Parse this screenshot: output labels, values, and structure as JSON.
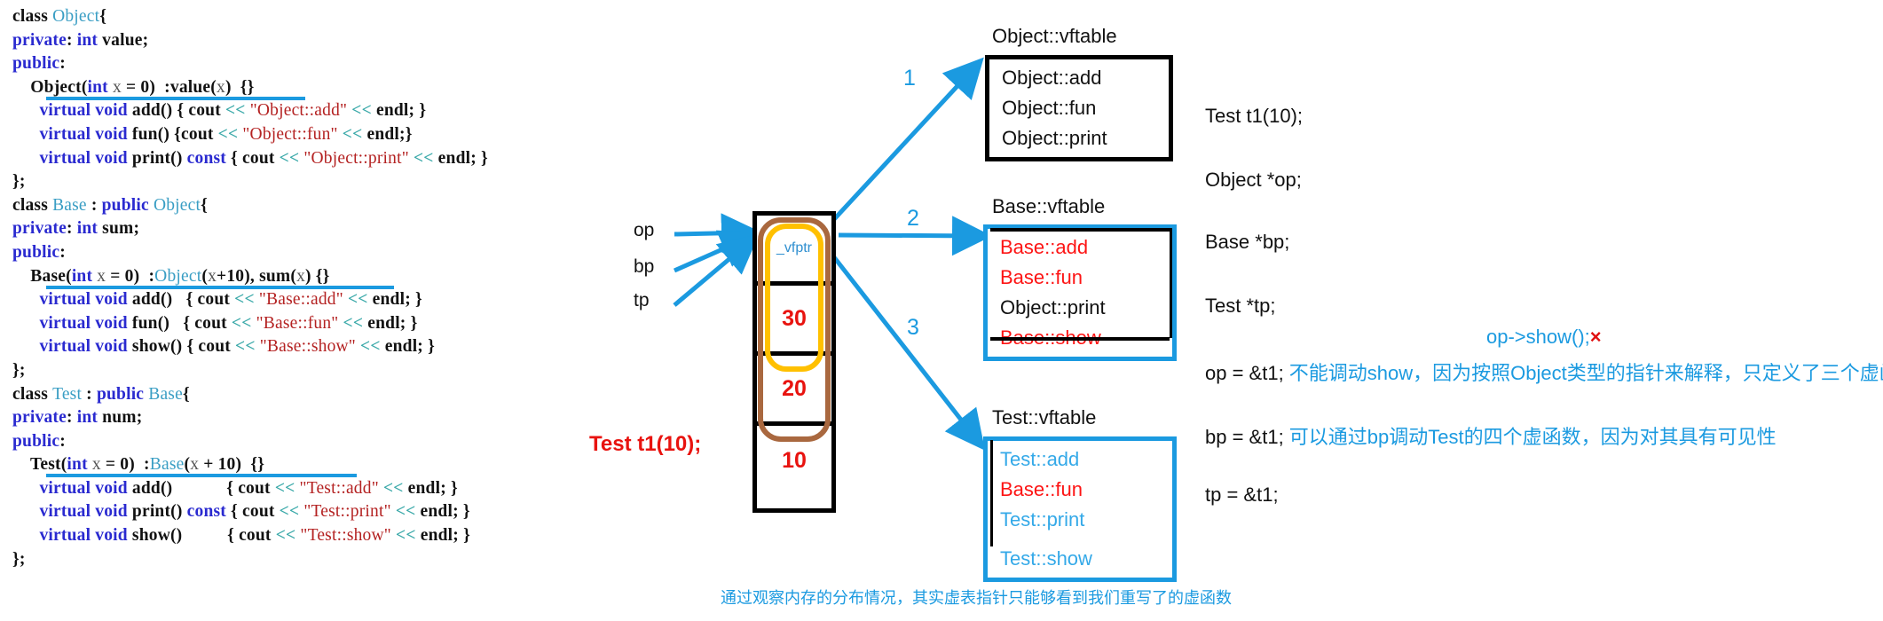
{
  "code": {
    "lines": [
      [
        {
          "t": "class ",
          "c": "plain"
        },
        {
          "t": "Object",
          "c": "typ"
        },
        {
          "t": "{",
          "c": "plain"
        }
      ],
      [
        {
          "t": "private",
          "c": "kw"
        },
        {
          "t": ": ",
          "c": "plain"
        },
        {
          "t": "int",
          "c": "kw"
        },
        {
          "t": " value;",
          "c": "plain"
        }
      ],
      [
        {
          "t": "public",
          "c": "kw"
        },
        {
          "t": ":",
          "c": "plain"
        }
      ],
      [
        {
          "t": "    Object",
          "c": "plain"
        },
        {
          "t": "(",
          "c": "plain"
        },
        {
          "t": "int",
          "c": "kw"
        },
        {
          "t": " ",
          "c": "plain"
        },
        {
          "t": "x",
          "c": "var"
        },
        {
          "t": " = ",
          "c": "plain"
        },
        {
          "t": "0",
          "c": "plain"
        },
        {
          "t": ")  :value",
          "c": "plain"
        },
        {
          "t": "(",
          "c": "plain"
        },
        {
          "t": "x",
          "c": "var"
        },
        {
          "t": ")  {}",
          "c": "plain"
        }
      ],
      [
        {
          "t": "      ",
          "c": "plain"
        },
        {
          "t": "virtual",
          "c": "kw"
        },
        {
          "t": " ",
          "c": "plain"
        },
        {
          "t": "void",
          "c": "kw"
        },
        {
          "t": " add() { cout ",
          "c": "plain"
        },
        {
          "t": "<<",
          "c": "op"
        },
        {
          "t": " ",
          "c": "plain"
        },
        {
          "t": "\"Object::add\"",
          "c": "str"
        },
        {
          "t": " ",
          "c": "plain"
        },
        {
          "t": "<<",
          "c": "op"
        },
        {
          "t": " endl; }",
          "c": "plain"
        }
      ],
      [
        {
          "t": "      ",
          "c": "plain"
        },
        {
          "t": "virtual",
          "c": "kw"
        },
        {
          "t": " ",
          "c": "plain"
        },
        {
          "t": "void",
          "c": "kw"
        },
        {
          "t": " fun() {cout ",
          "c": "plain"
        },
        {
          "t": "<<",
          "c": "op"
        },
        {
          "t": " ",
          "c": "plain"
        },
        {
          "t": "\"Object::fun\"",
          "c": "str"
        },
        {
          "t": " ",
          "c": "plain"
        },
        {
          "t": "<<",
          "c": "op"
        },
        {
          "t": " endl;}",
          "c": "plain"
        }
      ],
      [
        {
          "t": "      ",
          "c": "plain"
        },
        {
          "t": "virtual",
          "c": "kw"
        },
        {
          "t": " ",
          "c": "plain"
        },
        {
          "t": "void",
          "c": "kw"
        },
        {
          "t": " print() ",
          "c": "plain"
        },
        {
          "t": "const",
          "c": "kw"
        },
        {
          "t": " { cout ",
          "c": "plain"
        },
        {
          "t": "<<",
          "c": "op"
        },
        {
          "t": " ",
          "c": "plain"
        },
        {
          "t": "\"Object::print\"",
          "c": "str"
        },
        {
          "t": " ",
          "c": "plain"
        },
        {
          "t": "<<",
          "c": "op"
        },
        {
          "t": " endl; }",
          "c": "plain"
        }
      ],
      [
        {
          "t": "};",
          "c": "plain"
        }
      ],
      [
        {
          "t": "class ",
          "c": "plain"
        },
        {
          "t": "Base",
          "c": "typ"
        },
        {
          "t": " : ",
          "c": "plain"
        },
        {
          "t": "public",
          "c": "kw"
        },
        {
          "t": " ",
          "c": "plain"
        },
        {
          "t": "Object",
          "c": "typ"
        },
        {
          "t": "{",
          "c": "plain"
        }
      ],
      [
        {
          "t": "private",
          "c": "kw"
        },
        {
          "t": ": ",
          "c": "plain"
        },
        {
          "t": "int",
          "c": "kw"
        },
        {
          "t": " sum;",
          "c": "plain"
        }
      ],
      [
        {
          "t": "public",
          "c": "kw"
        },
        {
          "t": ":",
          "c": "plain"
        }
      ],
      [
        {
          "t": "    Base",
          "c": "plain"
        },
        {
          "t": "(",
          "c": "plain"
        },
        {
          "t": "int",
          "c": "kw"
        },
        {
          "t": " ",
          "c": "plain"
        },
        {
          "t": "x",
          "c": "var"
        },
        {
          "t": " = ",
          "c": "plain"
        },
        {
          "t": "0",
          "c": "plain"
        },
        {
          "t": ")  :",
          "c": "plain"
        },
        {
          "t": "Object",
          "c": "typ"
        },
        {
          "t": "(",
          "c": "plain"
        },
        {
          "t": "x",
          "c": "var"
        },
        {
          "t": "+10), sum",
          "c": "plain"
        },
        {
          "t": "(",
          "c": "plain"
        },
        {
          "t": "x",
          "c": "var"
        },
        {
          "t": ") {}",
          "c": "plain"
        }
      ],
      [
        {
          "t": "      ",
          "c": "plain"
        },
        {
          "t": "virtual",
          "c": "kw"
        },
        {
          "t": " ",
          "c": "plain"
        },
        {
          "t": "void",
          "c": "kw"
        },
        {
          "t": " add()   { cout ",
          "c": "plain"
        },
        {
          "t": "<<",
          "c": "op"
        },
        {
          "t": " ",
          "c": "plain"
        },
        {
          "t": "\"Base::add\"",
          "c": "str"
        },
        {
          "t": " ",
          "c": "plain"
        },
        {
          "t": "<<",
          "c": "op"
        },
        {
          "t": " endl; }",
          "c": "plain"
        }
      ],
      [
        {
          "t": "      ",
          "c": "plain"
        },
        {
          "t": "virtual",
          "c": "kw"
        },
        {
          "t": " ",
          "c": "plain"
        },
        {
          "t": "void",
          "c": "kw"
        },
        {
          "t": " fun()   { cout ",
          "c": "plain"
        },
        {
          "t": "<<",
          "c": "op"
        },
        {
          "t": " ",
          "c": "plain"
        },
        {
          "t": "\"Base::fun\"",
          "c": "str"
        },
        {
          "t": " ",
          "c": "plain"
        },
        {
          "t": "<<",
          "c": "op"
        },
        {
          "t": " endl; }",
          "c": "plain"
        }
      ],
      [
        {
          "t": "      ",
          "c": "plain"
        },
        {
          "t": "virtual",
          "c": "kw"
        },
        {
          "t": " ",
          "c": "plain"
        },
        {
          "t": "void",
          "c": "kw"
        },
        {
          "t": " show() { cout ",
          "c": "plain"
        },
        {
          "t": "<<",
          "c": "op"
        },
        {
          "t": " ",
          "c": "plain"
        },
        {
          "t": "\"Base::show\"",
          "c": "str"
        },
        {
          "t": " ",
          "c": "plain"
        },
        {
          "t": "<<",
          "c": "op"
        },
        {
          "t": " endl; }",
          "c": "plain"
        }
      ],
      [
        {
          "t": "};",
          "c": "plain"
        }
      ],
      [
        {
          "t": "class ",
          "c": "plain"
        },
        {
          "t": "Test",
          "c": "typ"
        },
        {
          "t": " : ",
          "c": "plain"
        },
        {
          "t": "public",
          "c": "kw"
        },
        {
          "t": " ",
          "c": "plain"
        },
        {
          "t": "Base",
          "c": "typ"
        },
        {
          "t": "{",
          "c": "plain"
        }
      ],
      [
        {
          "t": "private",
          "c": "kw"
        },
        {
          "t": ": ",
          "c": "plain"
        },
        {
          "t": "int",
          "c": "kw"
        },
        {
          "t": " num;",
          "c": "plain"
        }
      ],
      [
        {
          "t": "public",
          "c": "kw"
        },
        {
          "t": ":",
          "c": "plain"
        }
      ],
      [
        {
          "t": "    Test",
          "c": "plain"
        },
        {
          "t": "(",
          "c": "plain"
        },
        {
          "t": "int",
          "c": "kw"
        },
        {
          "t": " ",
          "c": "plain"
        },
        {
          "t": "x",
          "c": "var"
        },
        {
          "t": " = ",
          "c": "plain"
        },
        {
          "t": "0",
          "c": "plain"
        },
        {
          "t": ")  :",
          "c": "plain"
        },
        {
          "t": "Base",
          "c": "typ"
        },
        {
          "t": "(",
          "c": "plain"
        },
        {
          "t": "x",
          "c": "var"
        },
        {
          "t": " + 10)  {}",
          "c": "plain"
        }
      ],
      [
        {
          "t": "      ",
          "c": "plain"
        },
        {
          "t": "virtual",
          "c": "kw"
        },
        {
          "t": " ",
          "c": "plain"
        },
        {
          "t": "void",
          "c": "kw"
        },
        {
          "t": " add()            { cout ",
          "c": "plain"
        },
        {
          "t": "<<",
          "c": "op"
        },
        {
          "t": " ",
          "c": "plain"
        },
        {
          "t": "\"Test::add\"",
          "c": "str"
        },
        {
          "t": " ",
          "c": "plain"
        },
        {
          "t": "<<",
          "c": "op"
        },
        {
          "t": " endl; }",
          "c": "plain"
        }
      ],
      [
        {
          "t": "      ",
          "c": "plain"
        },
        {
          "t": "virtual",
          "c": "kw"
        },
        {
          "t": " ",
          "c": "plain"
        },
        {
          "t": "void",
          "c": "kw"
        },
        {
          "t": " print() ",
          "c": "plain"
        },
        {
          "t": "const",
          "c": "kw"
        },
        {
          "t": " { cout ",
          "c": "plain"
        },
        {
          "t": "<<",
          "c": "op"
        },
        {
          "t": " ",
          "c": "plain"
        },
        {
          "t": "\"Test::print\"",
          "c": "str"
        },
        {
          "t": " ",
          "c": "plain"
        },
        {
          "t": "<<",
          "c": "op"
        },
        {
          "t": " endl; }",
          "c": "plain"
        }
      ],
      [
        {
          "t": "      ",
          "c": "plain"
        },
        {
          "t": "virtual",
          "c": "kw"
        },
        {
          "t": " ",
          "c": "plain"
        },
        {
          "t": "void",
          "c": "kw"
        },
        {
          "t": " show()          { cout ",
          "c": "plain"
        },
        {
          "t": "<<",
          "c": "op"
        },
        {
          "t": " ",
          "c": "plain"
        },
        {
          "t": "\"Test::show\"",
          "c": "str"
        },
        {
          "t": " ",
          "c": "plain"
        },
        {
          "t": "<<",
          "c": "op"
        },
        {
          "t": " endl; }",
          "c": "plain"
        }
      ],
      [
        {
          "t": "};",
          "c": "plain"
        }
      ]
    ]
  },
  "memory": {
    "cells": [
      {
        "label": "_vfptr",
        "kind": "vfptr"
      },
      {
        "label": "30",
        "kind": "value"
      },
      {
        "label": "20",
        "kind": "value"
      },
      {
        "label": "10",
        "kind": "value"
      }
    ],
    "pointer_labels": [
      "op",
      "bp",
      "tp"
    ],
    "object_label": "Test t1(10);"
  },
  "vtables": [
    {
      "title": "Object::vftable",
      "border": "#000000",
      "entries": [
        {
          "text": "Object::add",
          "color": "black"
        },
        {
          "text": "Object::fun",
          "color": "black"
        },
        {
          "text": "Object::print",
          "color": "black"
        }
      ]
    },
    {
      "title": "Base::vftable",
      "border": "#1b9ae0",
      "entries": [
        {
          "text": "Base::add",
          "color": "red"
        },
        {
          "text": "Base::fun",
          "color": "red"
        },
        {
          "text": "Object::print",
          "color": "black"
        },
        {
          "text": "Base::show",
          "color": "red"
        }
      ]
    },
    {
      "title": "Test::vftable",
      "border": "#1b9ae0",
      "entries": [
        {
          "text": "Test::add",
          "color": "blue"
        },
        {
          "text": "Base::fun",
          "color": "red"
        },
        {
          "text": "Test::print",
          "color": "blue"
        },
        {
          "text": "Test::show",
          "color": "blue"
        }
      ]
    }
  ],
  "arrow_numbers": [
    "1",
    "2",
    "3"
  ],
  "right_column": {
    "lines": [
      {
        "text": "Test  t1(10);"
      },
      {
        "text": "Object *op;"
      },
      {
        "text": "Base *bp;"
      },
      {
        "text": "Test *tp;"
      }
    ],
    "op_show_call": "op->show();",
    "op_show_mark": "×",
    "assignments": [
      {
        "code": "op = &t1; ",
        "note": "不能调动show，因为按照Object类型的指针来解释，只定义了三个虚函数"
      },
      {
        "code": "bp = &t1; ",
        "note": "可以通过bp调动Test的四个虚函数，因为对其具有可见性"
      },
      {
        "code": "tp = &t1;",
        "note": ""
      }
    ]
  },
  "bottom_caption": "通过观察内存的分布情况，其实虚表指针只能够看到我们重写了的虚函数",
  "colors": {
    "accent_blue": "#1b9ae0",
    "red": "#e8130f",
    "brown": "#a9683f",
    "yellow": "#ffc000",
    "entry_blue": "#34a9e8"
  }
}
